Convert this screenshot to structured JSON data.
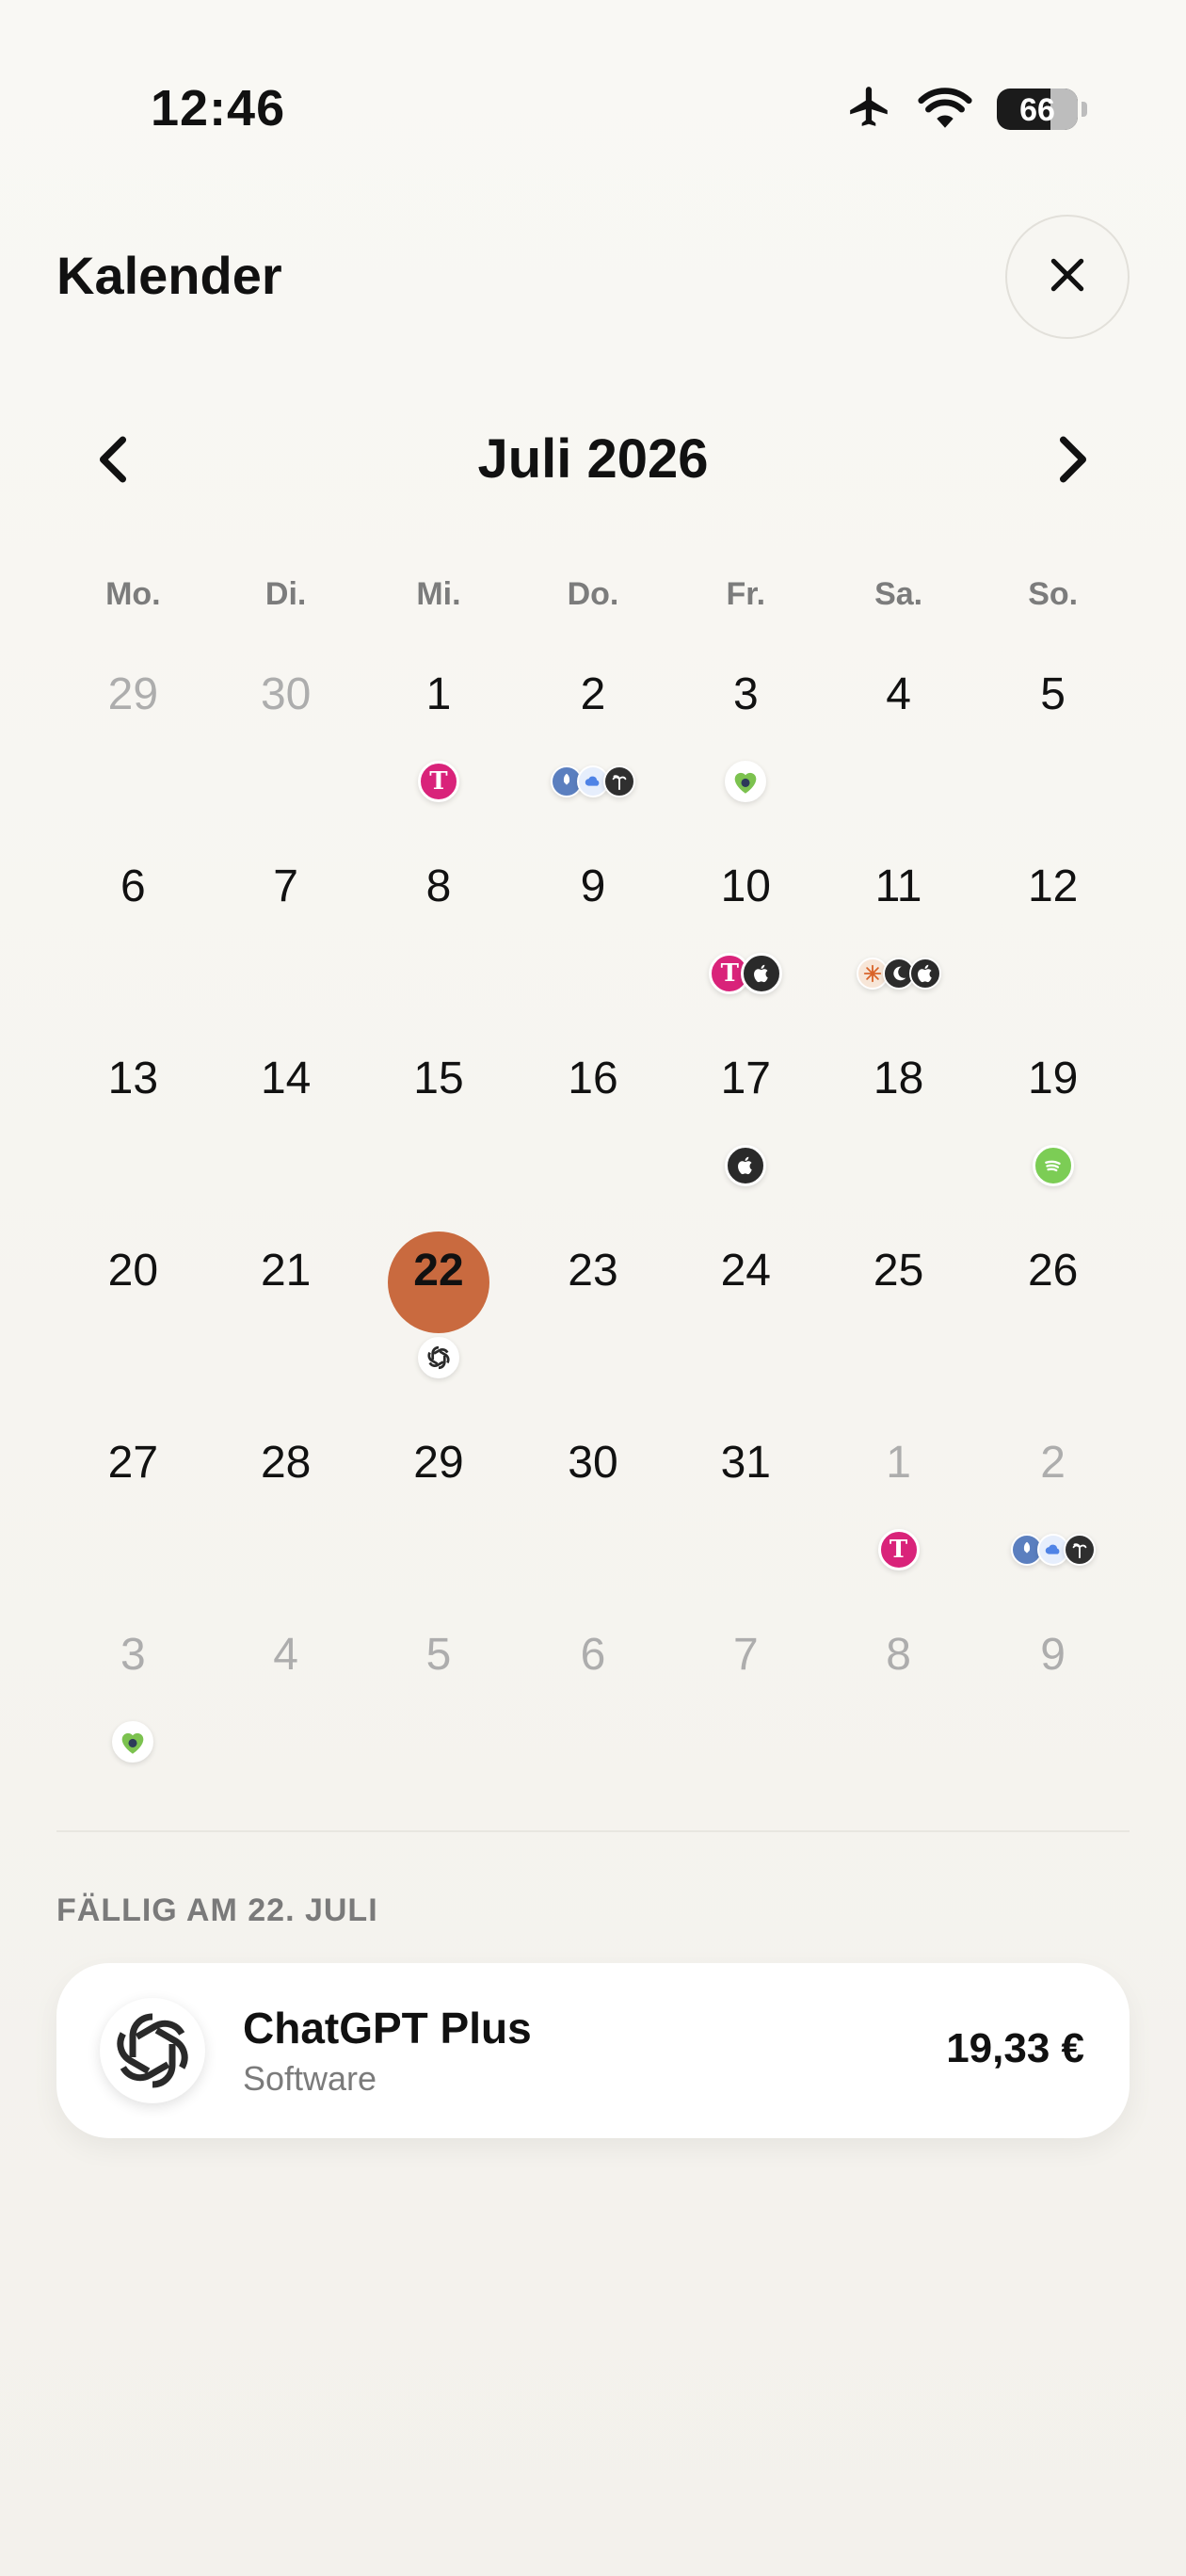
{
  "status": {
    "time": "12:46",
    "battery": "66"
  },
  "header": {
    "title": "Kalender"
  },
  "nav": {
    "month": "Juli 2026"
  },
  "weekdays": [
    "Mo.",
    "Di.",
    "Mi.",
    "Do.",
    "Fr.",
    "Sa.",
    "So."
  ],
  "weeks": [
    [
      {
        "n": "29",
        "muted": true
      },
      {
        "n": "30",
        "muted": true
      },
      {
        "n": "1",
        "icons": [
          "telekom"
        ]
      },
      {
        "n": "2",
        "icons": [
          "rocket",
          "cloud",
          "palm"
        ]
      },
      {
        "n": "3",
        "icons": [
          "heart"
        ]
      },
      {
        "n": "4"
      },
      {
        "n": "5"
      }
    ],
    [
      {
        "n": "6"
      },
      {
        "n": "7"
      },
      {
        "n": "8"
      },
      {
        "n": "9"
      },
      {
        "n": "10",
        "icons": [
          "telekom",
          "apple"
        ]
      },
      {
        "n": "11",
        "icons": [
          "sun",
          "moon",
          "apple"
        ]
      },
      {
        "n": "12"
      }
    ],
    [
      {
        "n": "13"
      },
      {
        "n": "14"
      },
      {
        "n": "15"
      },
      {
        "n": "16"
      },
      {
        "n": "17",
        "icons": [
          "apple"
        ]
      },
      {
        "n": "18"
      },
      {
        "n": "19",
        "icons": [
          "spotify"
        ]
      }
    ],
    [
      {
        "n": "20"
      },
      {
        "n": "21"
      },
      {
        "n": "22",
        "selected": true,
        "icons": [
          "openai"
        ]
      },
      {
        "n": "23"
      },
      {
        "n": "24"
      },
      {
        "n": "25"
      },
      {
        "n": "26"
      }
    ],
    [
      {
        "n": "27"
      },
      {
        "n": "28"
      },
      {
        "n": "29"
      },
      {
        "n": "30"
      },
      {
        "n": "31"
      },
      {
        "n": "1",
        "muted": true,
        "icons": [
          "telekom"
        ]
      },
      {
        "n": "2",
        "muted": true,
        "icons": [
          "rocket",
          "cloud",
          "palm"
        ]
      }
    ],
    [
      {
        "n": "3",
        "muted": true,
        "icons": [
          "heart"
        ]
      },
      {
        "n": "4",
        "muted": true
      },
      {
        "n": "5",
        "muted": true
      },
      {
        "n": "6",
        "muted": true
      },
      {
        "n": "7",
        "muted": true
      },
      {
        "n": "8",
        "muted": true
      },
      {
        "n": "9",
        "muted": true
      }
    ]
  ],
  "due": {
    "label": "FÄLLIG AM 22. JULI",
    "item": {
      "name": "ChatGPT Plus",
      "category": "Software",
      "amount": "19,33 €",
      "icon": "openai-icon"
    }
  },
  "colors": {
    "accent": "#c96a3f",
    "telekom": "#d9237a",
    "spotify": "#7ccd55"
  }
}
